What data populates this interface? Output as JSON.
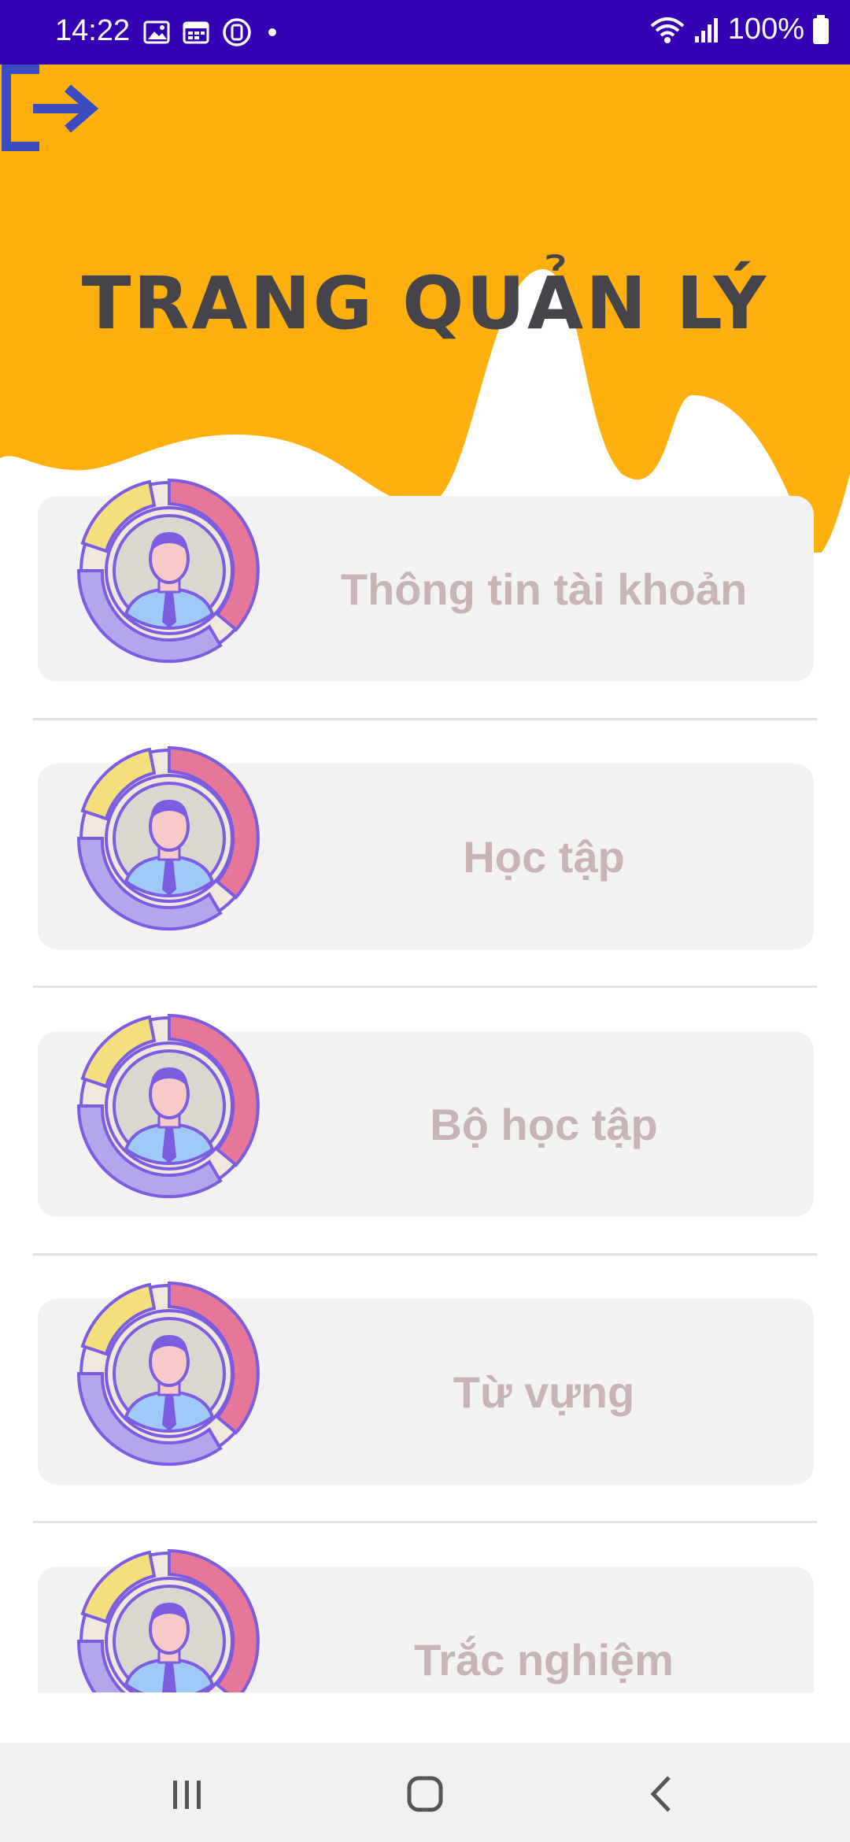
{
  "status_bar": {
    "time": "14:22",
    "battery": "100%",
    "icons": [
      "image-icon",
      "calendar-icon",
      "sync-icon",
      "dot-icon",
      "wifi-icon",
      "signal-icon",
      "battery-icon"
    ]
  },
  "header": {
    "title": "TRANG QUẢN LÝ",
    "logout_icon": "logout-icon",
    "colors": {
      "banner": "#ffb00f",
      "title": "#45444b",
      "logout": "#3b4cc0"
    }
  },
  "menu": {
    "items": [
      {
        "label": "Thông tin tài khoản"
      },
      {
        "label": "Học tập"
      },
      {
        "label": "Bộ học tập"
      },
      {
        "label": "Từ vựng"
      },
      {
        "label": "Trắc nghiệm"
      }
    ]
  },
  "nav_bar": {
    "buttons": [
      "recent-apps-icon",
      "home-icon",
      "back-icon"
    ]
  }
}
